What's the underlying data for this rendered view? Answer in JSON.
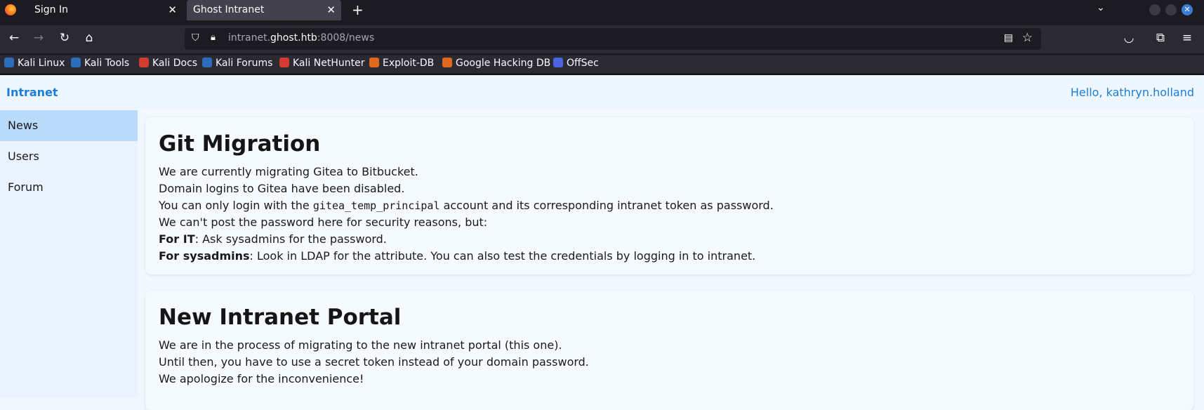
{
  "browser": {
    "tabs": [
      {
        "title": "Sign In",
        "active": false
      },
      {
        "title": "Ghost Intranet",
        "active": true
      }
    ],
    "url": {
      "prefix": "intranet.",
      "host": "ghost.htb",
      "rest": ":8008/news"
    },
    "bookmarks": [
      {
        "label": "Kali Linux",
        "color": "#2a6ebb"
      },
      {
        "label": "Kali Tools",
        "color": "#2a6ebb"
      },
      {
        "label": "Kali Docs",
        "color": "#d43b2f"
      },
      {
        "label": "Kali Forums",
        "color": "#2a6ebb"
      },
      {
        "label": "Kali NetHunter",
        "color": "#d43b2f"
      },
      {
        "label": "Exploit-DB",
        "color": "#e0681d"
      },
      {
        "label": "Google Hacking DB",
        "color": "#e0681d"
      },
      {
        "label": "OffSec",
        "color": "#4a64e0"
      }
    ]
  },
  "app": {
    "brand": "Intranet",
    "greeting": "Hello, kathryn.holland",
    "accent": "#1d7ed8"
  },
  "sidebar": {
    "items": [
      {
        "label": "News",
        "active": true
      },
      {
        "label": "Users",
        "active": false
      },
      {
        "label": "Forum",
        "active": false
      }
    ]
  },
  "news": [
    {
      "title": "Git Migration",
      "line1": "We are currently migrating Gitea to Bitbucket.",
      "line2": "Domain logins to Gitea have been disabled.",
      "line3_pre": "You can only login with the ",
      "line3_code": "gitea_temp_principal",
      "line3_post": " account and its corresponding intranet token as password.",
      "line4": "We can't post the password here for security reasons, but:",
      "line5_bold": "For IT",
      "line5_rest": ": Ask sysadmins for the password.",
      "line6_bold": "For sysadmins",
      "line6_rest": ": Look in LDAP for the attribute. You can also test the credentials by logging in to intranet."
    },
    {
      "title": "New Intranet Portal",
      "line1": "We are in the process of migrating to the new intranet portal (this one).",
      "line2": "Until then, you have to use a secret token instead of your domain password.",
      "line3": "We apologize for the inconvenience!"
    }
  ]
}
